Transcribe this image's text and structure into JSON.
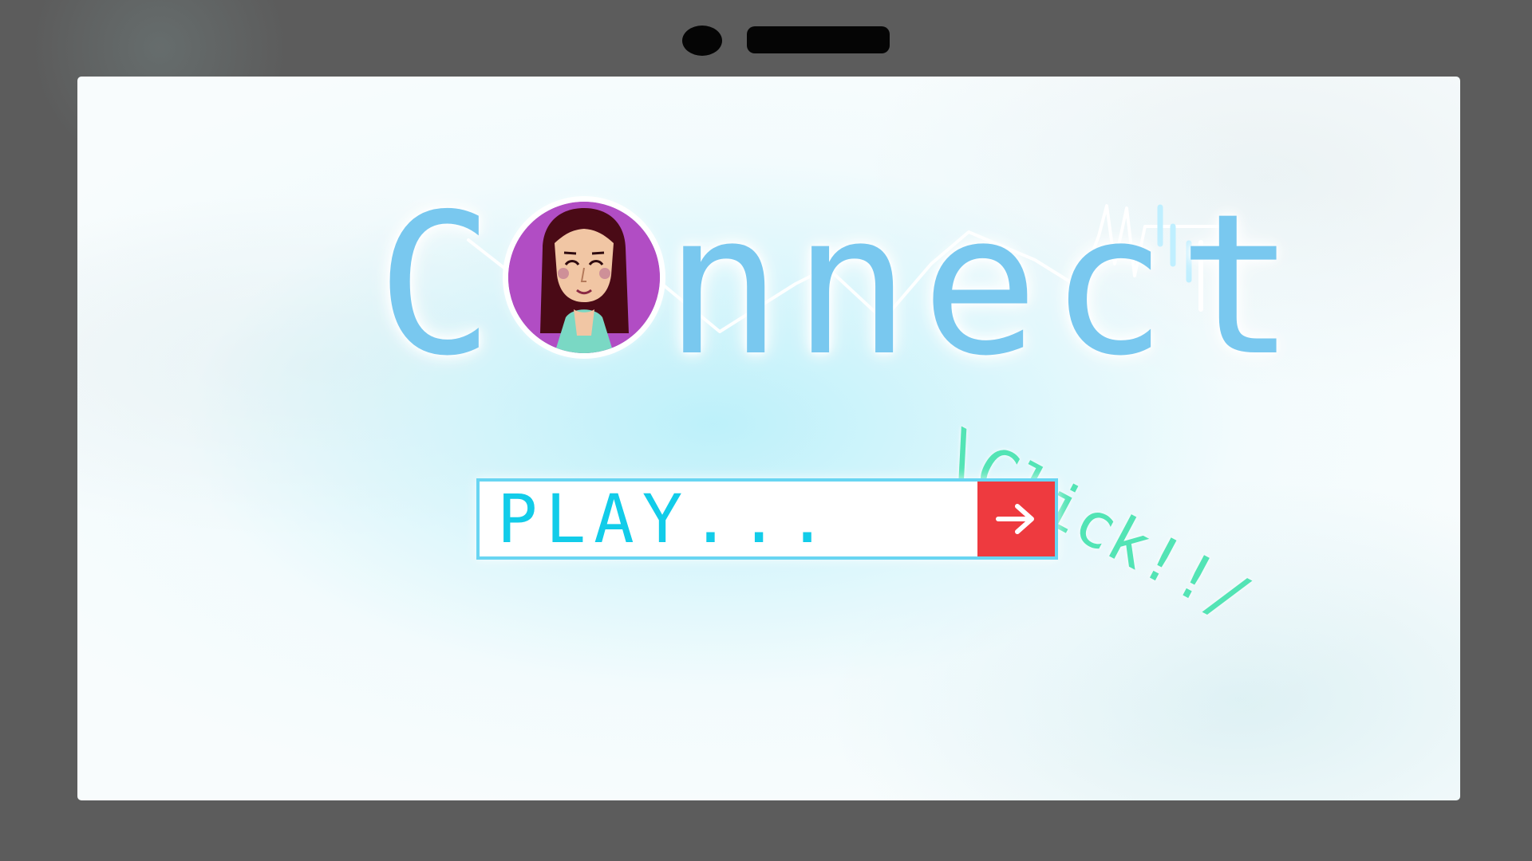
{
  "title": {
    "first_letter": "C",
    "remaining_letters": "nnect"
  },
  "callout": {
    "text": "\\Click!!/"
  },
  "start_bar": {
    "label": "PLAY...",
    "button_icon": "arrow-right-icon"
  },
  "icons": {
    "camera": "camera-icon",
    "speaker": "speaker-icon",
    "avatar": "avatar-icon",
    "pulse": "heartbeat-icon"
  },
  "colors": {
    "bezel": "#5c5c5c",
    "title": "#79c8ef",
    "avatar_background": "#b14dc4",
    "play_text": "#12cce9",
    "play_border": "#68d5f2",
    "button": "#ee3a3f",
    "callout": "#53e4b5"
  }
}
